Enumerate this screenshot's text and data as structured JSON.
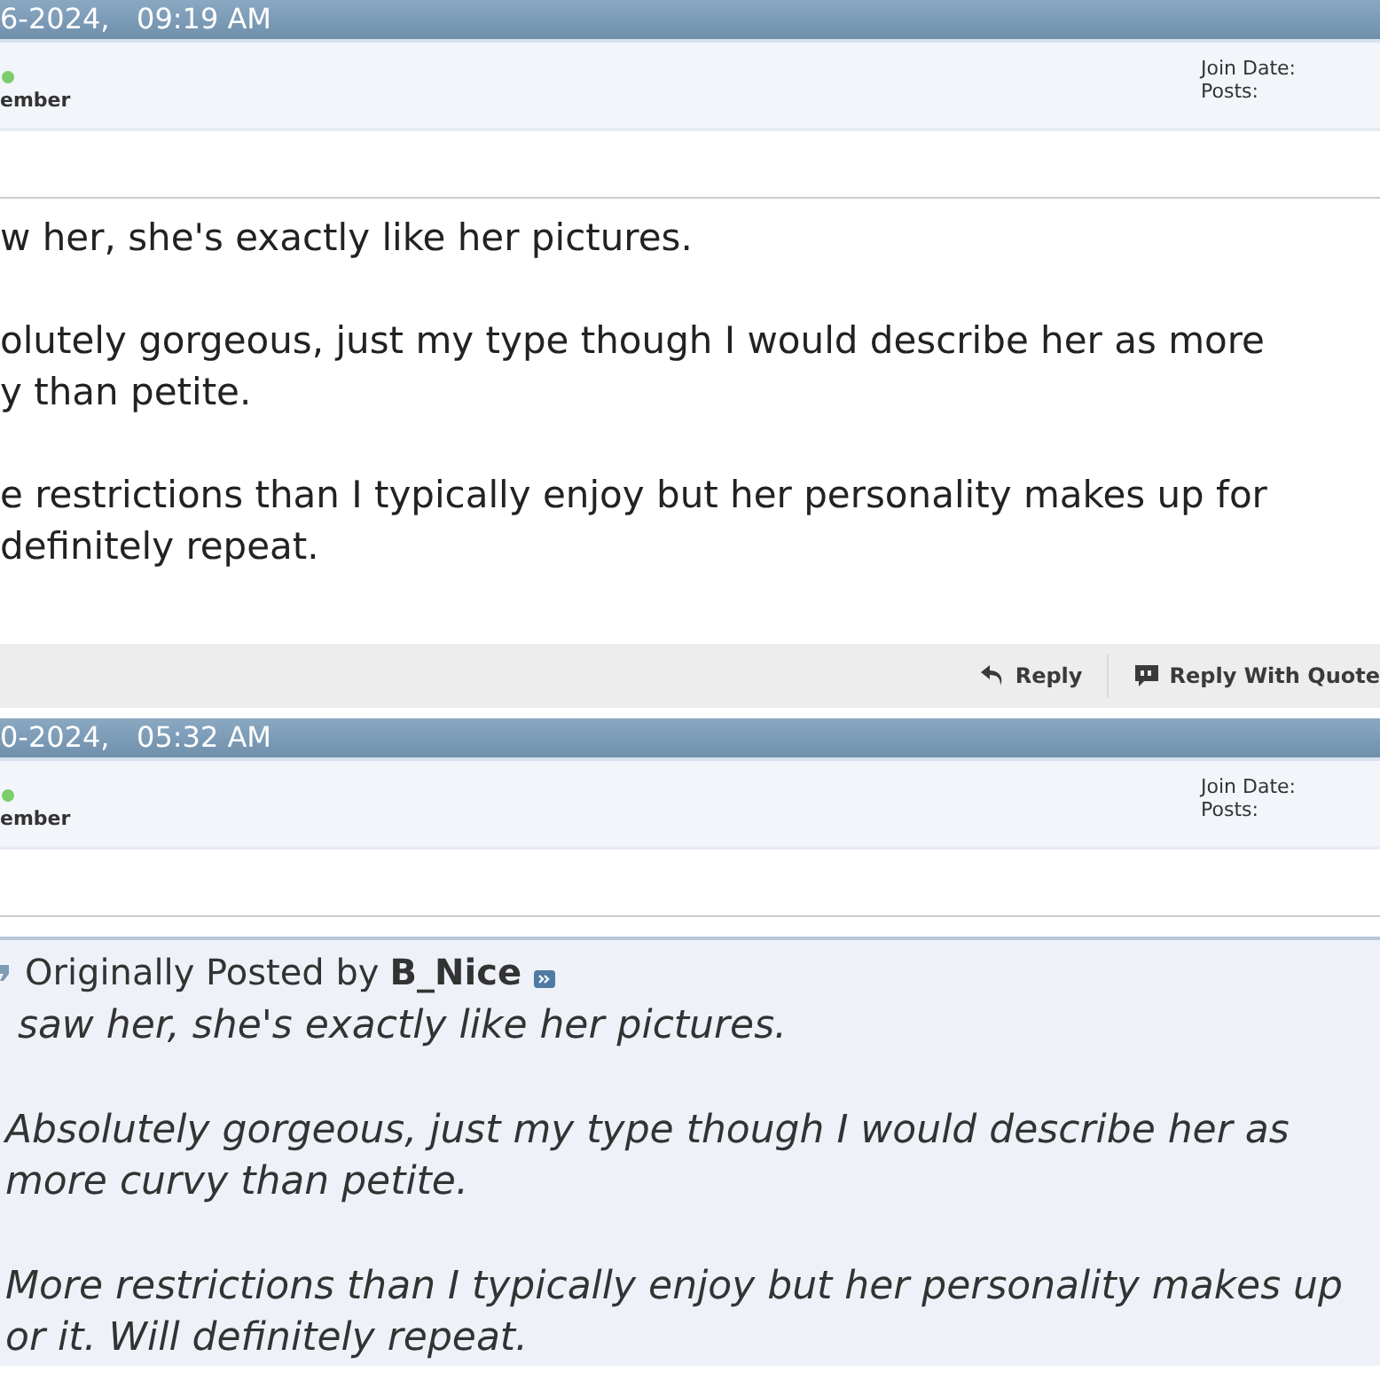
{
  "posts": [
    {
      "date": "6-2024,   09:19 AM",
      "online": true,
      "rank": "ember",
      "join_label": "Join Date:",
      "posts_label": "Posts:",
      "paragraphs": [
        [
          "w her, she's exactly like her pictures."
        ],
        [
          "olutely gorgeous, just my type though I would describe her as more",
          "y than petite."
        ],
        [
          "e restrictions than I typically enjoy but her personality makes up for",
          "definitely repeat."
        ]
      ],
      "buttons": [
        {
          "kind": "reply",
          "label": "Reply"
        },
        {
          "kind": "quote",
          "label": "Reply With Quote"
        }
      ]
    },
    {
      "date": "0-2024,   05:32 AM",
      "online": true,
      "rank": "ember",
      "join_label": "Join Date:",
      "posts_label": "Posts:",
      "quote": {
        "prefix": "Originally Posted by",
        "author": "B_Nice",
        "paragraphs": [
          [
            " saw her, she's exactly like her pictures."
          ],
          [
            "Absolutely gorgeous, just my type though I would describe her as",
            "more curvy than petite."
          ],
          [
            "More restrictions than I typically enjoy but her personality makes up",
            "or it. Will definitely repeat."
          ]
        ]
      }
    }
  ]
}
